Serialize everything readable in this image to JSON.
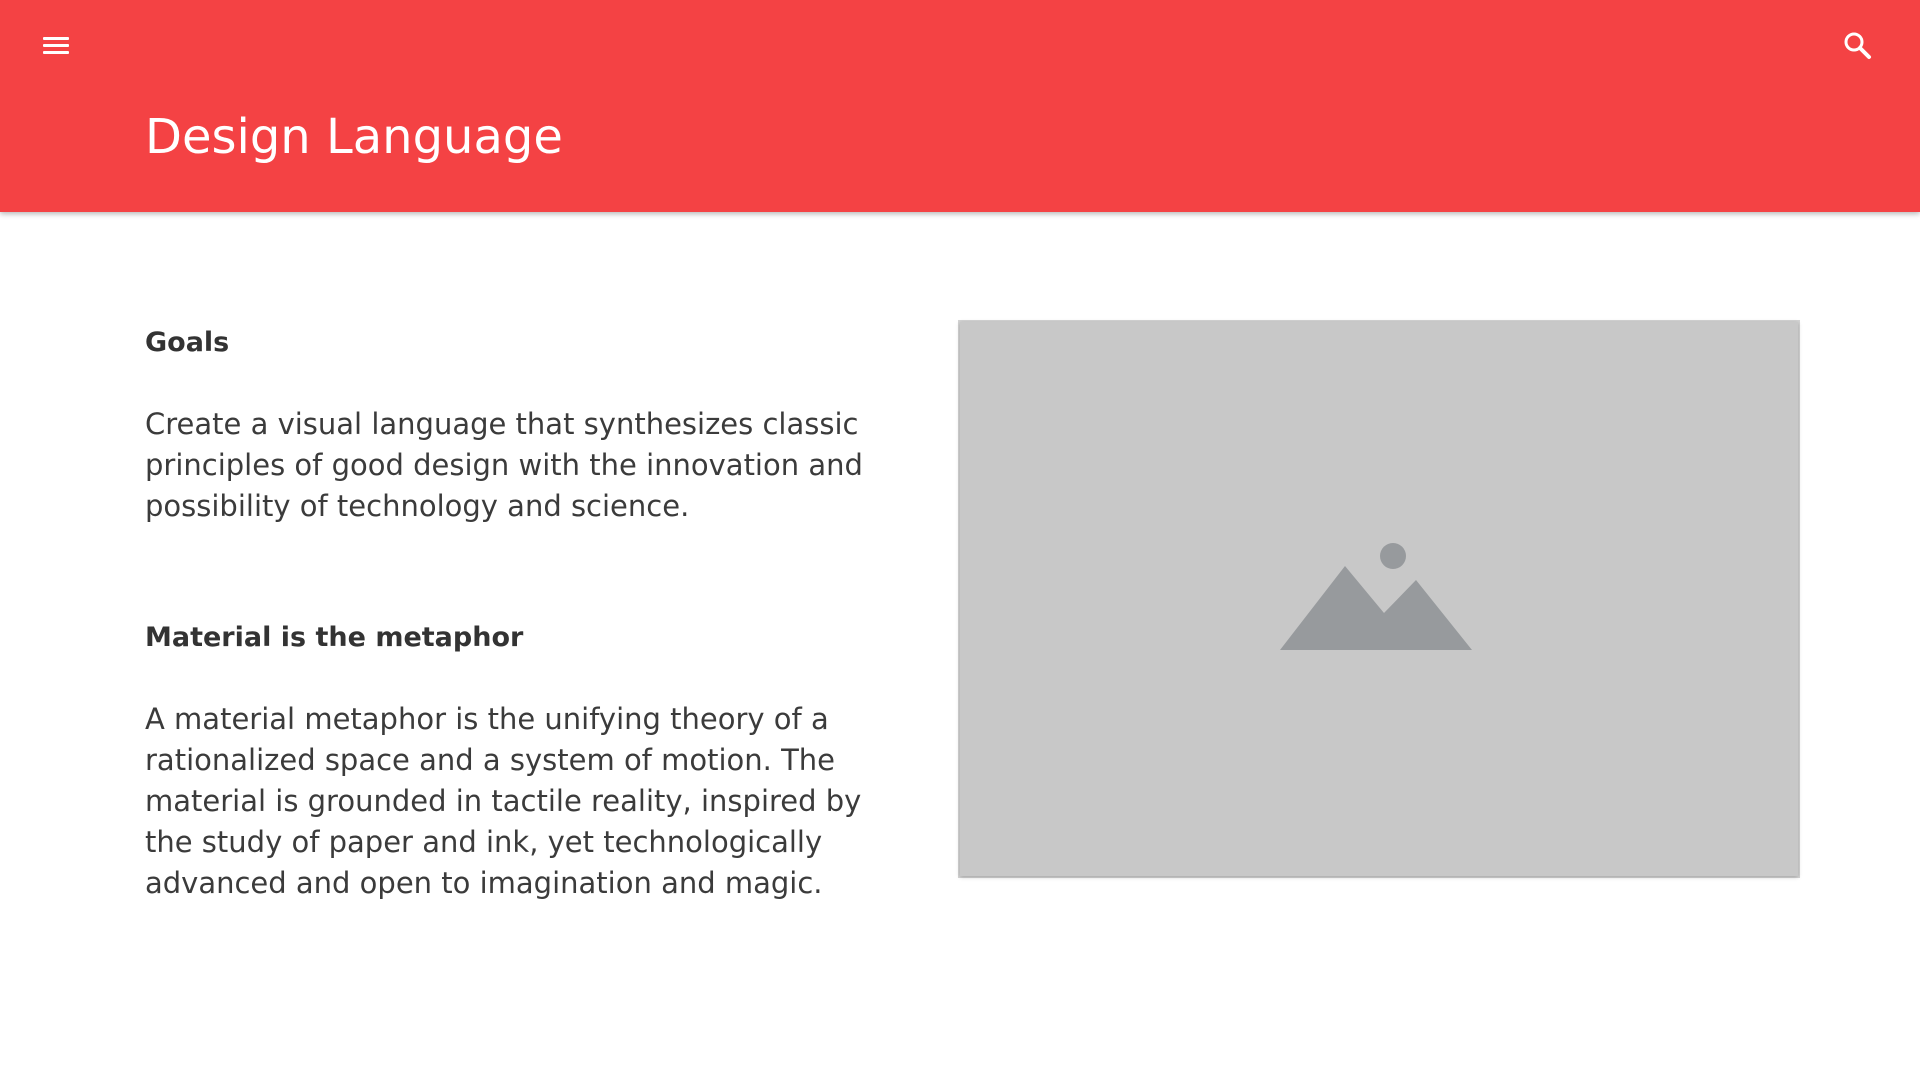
{
  "app_bar": {
    "title": "Design Language",
    "menu_icon": "menu-icon",
    "search_icon": "search-icon",
    "color": "#f44244"
  },
  "sections": [
    {
      "heading": "Goals",
      "body": "Create a visual language that synthesizes classic principles of good design with the innovation and possibility of technology and science."
    },
    {
      "heading": "Material is the metaphor",
      "body": "A material metaphor is the unifying theory of a rationalized space and a system of motion. The material is grounded in tactile reality, inspired by the study of paper and ink, yet technologically advanced and open to imagination and magic."
    }
  ],
  "image_card": {
    "icon": "image-placeholder-icon",
    "background": "#c8c8c8"
  }
}
